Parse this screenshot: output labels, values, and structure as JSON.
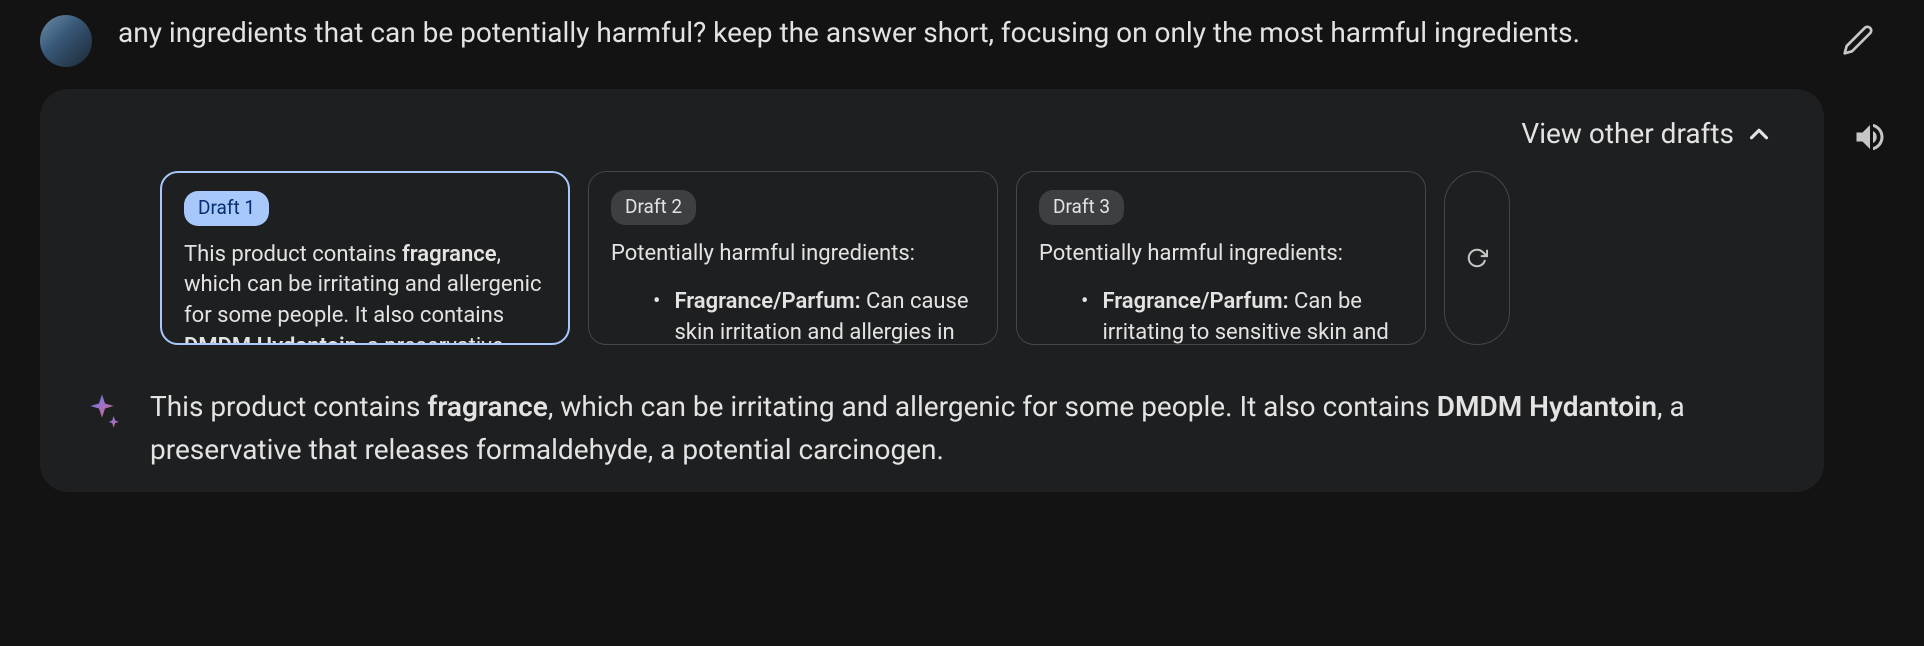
{
  "user_prompt": "any ingredients that can be potentially harmful? keep the answer short, focusing on only the most harmful ingredients.",
  "view_other_drafts_label": "View other drafts",
  "drafts": [
    {
      "label": "Draft 1",
      "selected": true,
      "preview_leading": "This product contains ",
      "preview_bold1": "fragrance",
      "preview_mid": ", which can be irritating and allergenic for some people. It also contains ",
      "preview_bold2": "DMDM Hydantoin",
      "preview_trailing": ", a preservative"
    },
    {
      "label": "Draft 2",
      "selected": false,
      "heading": "Potentially harmful ingredients:",
      "bullet_bold": "Fragrance/Parfum:",
      "bullet_rest": " Can cause skin irritation and allergies in"
    },
    {
      "label": "Draft 3",
      "selected": false,
      "heading": "Potentially harmful ingredients:",
      "bullet_bold": "Fragrance/Parfum:",
      "bullet_rest": " Can be irritating to sensitive skin and"
    }
  ],
  "answer": {
    "t1": "This product contains ",
    "b1": "fragrance",
    "t2": ", which can be irritating and allergenic for some people. It also contains ",
    "b2": "DMDM Hydantoin",
    "t3": ", a preservative that releases formaldehyde, a potential carcinogen."
  }
}
